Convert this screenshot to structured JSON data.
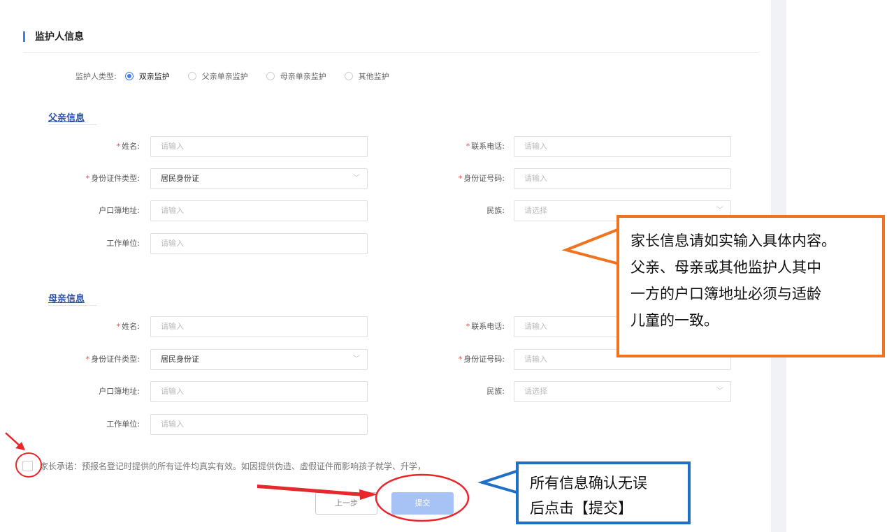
{
  "section": {
    "title": "监护人信息"
  },
  "guardian_type": {
    "label": "监护人类型:",
    "options": [
      "双亲监护",
      "父亲单亲监护",
      "母亲单亲监护",
      "其他监护"
    ],
    "selected": "双亲监护"
  },
  "father": {
    "title": "父亲信息",
    "name_label": "姓名:",
    "name_placeholder": "请输入",
    "phone_label": "联系电话:",
    "phone_placeholder": "请输入",
    "idtype_label": "身份证件类型:",
    "idtype_value": "居民身份证",
    "idno_label": "身份证号码:",
    "idno_placeholder": "请输入",
    "hukou_label": "户口簿地址:",
    "hukou_placeholder": "请输入",
    "ethnic_label": "民族:",
    "ethnic_placeholder": "请选择",
    "work_label": "工作单位:",
    "work_placeholder": "请输入"
  },
  "mother": {
    "title": "母亲信息",
    "name_label": "姓名:",
    "name_placeholder": "请输入",
    "phone_label": "联系电话:",
    "phone_placeholder": "请输入",
    "idtype_label": "身份证件类型:",
    "idtype_value": "居民身份证",
    "idno_label": "身份证号码:",
    "idno_placeholder": "请输入",
    "hukou_label": "户口簿地址:",
    "hukou_placeholder": "请输入",
    "ethnic_label": "民族:",
    "ethnic_placeholder": "请选择",
    "work_label": "工作单位:",
    "work_placeholder": "请输入"
  },
  "promise_text": "家长承诺：预报名登记时提供的所有证件均真实有效。如因提供伪造、虚假证件而影响孩子就学、升学，",
  "buttons": {
    "prev": "上一步",
    "submit": "提交"
  },
  "callouts": {
    "orange_lines": [
      "家长信息请如实输入具体内容。",
      "父亲、母亲或其他监护人其中",
      "一方的户口簿地址必须与适龄",
      "儿童的一致。"
    ],
    "blue_lines": [
      "所有信息确认无误",
      "后点击【提交】"
    ]
  },
  "colors": {
    "accent": "#3f7cf3",
    "orange": "#f07320",
    "blue": "#1f6fc4",
    "red": "#e8262b"
  }
}
